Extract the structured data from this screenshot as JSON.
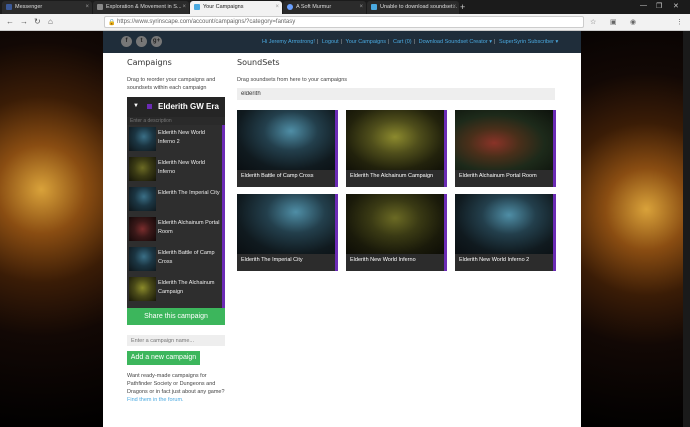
{
  "browser": {
    "tabs": [
      {
        "label": "Messenger",
        "color": "#3b5998"
      },
      {
        "label": "Exploration & Movement in S...",
        "color": "#888888"
      },
      {
        "label": "Your Campaigns",
        "color": "#4aa9e0"
      },
      {
        "label": "A Soft Murmur",
        "color": "#6aa0ff"
      },
      {
        "label": "Unable to download soundset...",
        "color": "#4aa9e0"
      }
    ],
    "url": "https://www.syrinscape.com/account/campaigns/?category=fantasy"
  },
  "social": [
    "f",
    "t",
    "g+"
  ],
  "topnav": [
    "Hi Jeremy Armstrong!",
    "Logout",
    "Your Campaigns",
    "Cart (0)",
    "Download Soundset Creator ▾",
    "SuperSyrin Subscriber ▾"
  ],
  "campaigns": {
    "heading": "Campaigns",
    "hint": "Drag to reorder your campaigns and soundsets within each campaign",
    "campaign_title": "Elderith GW Era",
    "description_placeholder": "Enter a description",
    "items": [
      {
        "label": "Elderith New World Inferno 2"
      },
      {
        "label": "Elderith New World Inferno"
      },
      {
        "label": "Elderith The Imperial City"
      },
      {
        "label": "Elderith Alchainum Portal Room"
      },
      {
        "label": "Elderith Battle of Camp Cross"
      },
      {
        "label": "Elderith The Alchainum Campaign"
      }
    ],
    "share_label": "Share this campaign",
    "new_placeholder": "Enter a campaign name...",
    "add_label": "Add a new campaign",
    "promo_text": "Want ready-made campaigns for Pathfinder Society or Dungeons and Dragons or in fact just about any game?",
    "promo_link": "Find them in the forum."
  },
  "soundsets": {
    "heading": "SoundSets",
    "hint": "Drag soundsets from here to your campaigns",
    "search_value": "elderith",
    "cards": [
      {
        "title": "Elderith Battle of Camp Cross"
      },
      {
        "title": "Elderith The Alchainum Campaign"
      },
      {
        "title": "Elderith Alchainum Portal Room"
      },
      {
        "title": "Elderith The Imperial City"
      },
      {
        "title": "Elderith New World Inferno"
      },
      {
        "title": "Elderith New World Inferno 2"
      }
    ]
  },
  "colors": {
    "accent_purple": "#6b2bb5",
    "button_green": "#3cb65c",
    "link_blue": "#4aa9e0"
  }
}
